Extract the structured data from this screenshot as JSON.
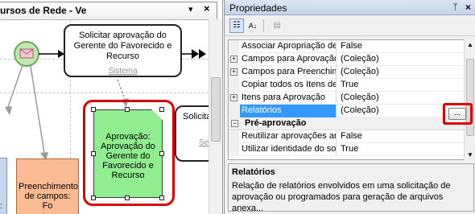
{
  "designer": {
    "tab_title": "ursos de Rede - Ve",
    "tab_dropdown": "▾",
    "tab_close": "×",
    "task_request": {
      "label": "Solicitar aprovação do Gerente do Favorecido e Recurso",
      "sublabel": "Sistema"
    },
    "task_right_partial": {
      "label": "Solicita",
      "sublabel": "Se"
    },
    "task_approval": {
      "label": "Aprovação: Aprovação do Gerente do Favorecido e Recurso"
    },
    "task_fill": {
      "label": "Preenchimento de campos: Fo"
    },
    "blue_shape_text": "s:"
  },
  "properties": {
    "title": "Propriedades",
    "pin_glyph": "ᛘ",
    "close_glyph": "×",
    "toolbar": {
      "categorized_glyph": "☷",
      "alphabetical_glyph": "A↓",
      "pages_glyph": "▤"
    },
    "rows": [
      {
        "name": "Associar Apropriação de",
        "value": "False",
        "expandable": false
      },
      {
        "name": "Campos para Aprovação",
        "value": "(Coleção)",
        "expandable": true
      },
      {
        "name": "Campos para Preenchime",
        "value": "(Coleção)",
        "expandable": true
      },
      {
        "name": "Copiar todos os Itens de",
        "value": "True",
        "expandable": false
      },
      {
        "name": "Itens para Aprovação",
        "value": "(Coleção)",
        "expandable": true
      },
      {
        "name": "Relatórios",
        "value": "(Coleção)",
        "expandable": false
      }
    ],
    "category": {
      "name": "Pré-aprovação",
      "collapse_glyph": "−"
    },
    "rows_after": [
      {
        "name": "Reutilizar aprovações ante",
        "value": "False"
      },
      {
        "name": "Utilizar identidade do sol",
        "value": "True"
      }
    ],
    "ellipsis_label": "...",
    "description": {
      "title": "Relatórios",
      "text": "Relação de relatórios envolvidos em uma solicitação de aprovação ou programados para geração de arquivos anexa..."
    }
  },
  "colors": {
    "approval_fill": "#90ee90",
    "fill_task": "#fabb94",
    "highlight": "#dd0000",
    "selected_row": "#3399ff"
  }
}
